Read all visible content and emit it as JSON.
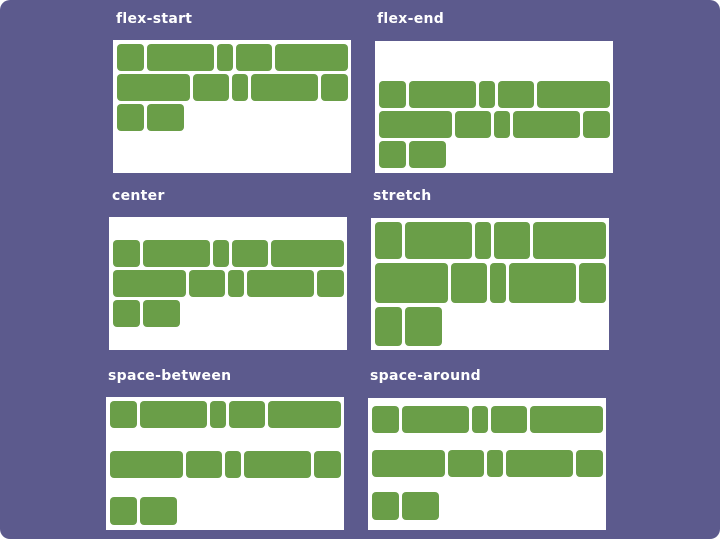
{
  "panels": [
    {
      "id": "flex-start",
      "title": "flex-start"
    },
    {
      "id": "flex-end",
      "title": "flex-end"
    },
    {
      "id": "center",
      "title": "center"
    },
    {
      "id": "stretch",
      "title": "stretch"
    },
    {
      "id": "space-between",
      "title": "space-between"
    },
    {
      "id": "space-around",
      "title": "space-around"
    }
  ],
  "item_color": "#6a9e48",
  "background_color": "#5c5a8d",
  "container_color": "#ffffff",
  "items_per_panel": 12,
  "rows_per_panel": 3
}
